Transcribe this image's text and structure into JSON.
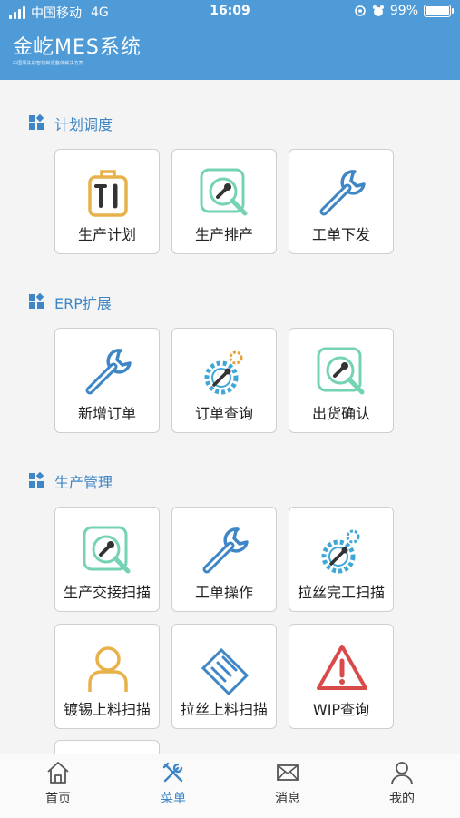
{
  "status_bar": {
    "carrier": "中国移动",
    "network": "4G",
    "time": "16:09",
    "battery_text": "99%",
    "battery_level": 0.99
  },
  "app": {
    "title": "金屹MES系统",
    "subtitle": "中国领先的智能制造整体解决方案"
  },
  "sections": [
    {
      "title": "计划调度",
      "items": [
        {
          "label": "生产计划",
          "icon": "toolbox-icon"
        },
        {
          "label": "生产排产",
          "icon": "wrench-magnifier-icon"
        },
        {
          "label": "工单下发",
          "icon": "wrench-icon"
        }
      ]
    },
    {
      "title": "ERP扩展",
      "items": [
        {
          "label": "新增订单",
          "icon": "wrench-icon"
        },
        {
          "label": "订单查询",
          "icon": "gear-wrench-icon"
        },
        {
          "label": "出货确认",
          "icon": "wrench-magnifier-icon"
        }
      ]
    },
    {
      "title": "生产管理",
      "items": [
        {
          "label": "生产交接扫描",
          "icon": "wrench-magnifier-icon"
        },
        {
          "label": "工单操作",
          "icon": "wrench-icon"
        },
        {
          "label": "拉丝完工扫描",
          "icon": "gear-wrench-icon"
        },
        {
          "label": "镀锡上料扫描",
          "icon": "user-icon"
        },
        {
          "label": "拉丝上料扫描",
          "icon": "handshake-icon"
        },
        {
          "label": "WIP查询",
          "icon": "warning-icon"
        }
      ]
    }
  ],
  "tabbar": {
    "items": [
      {
        "label": "首页",
        "icon": "home-icon"
      },
      {
        "label": "菜单",
        "icon": "tools-icon",
        "active": true
      },
      {
        "label": "消息",
        "icon": "mail-icon"
      },
      {
        "label": "我的",
        "icon": "person-icon"
      }
    ]
  },
  "colors": {
    "header": "#4f9bd8",
    "section_title": "#3e86c6",
    "tab_active": "#3e86c6",
    "tab_inactive": "#333333"
  }
}
